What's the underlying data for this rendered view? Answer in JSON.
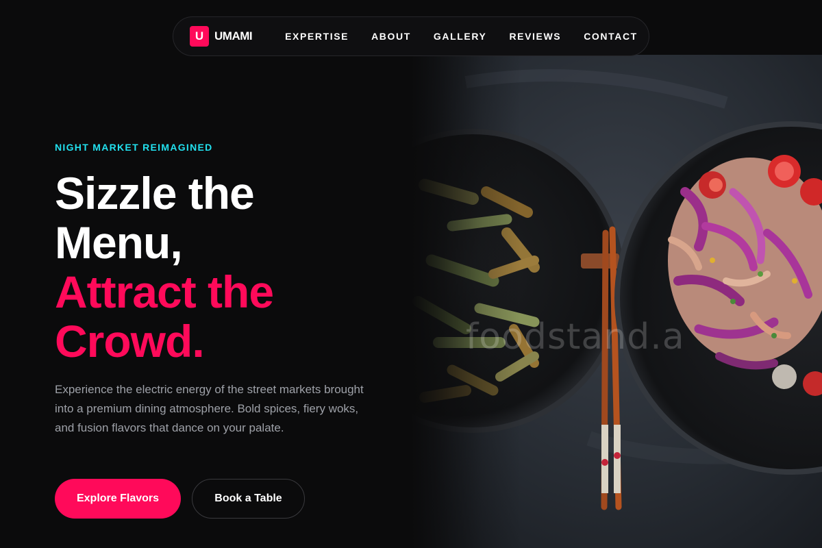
{
  "nav": {
    "brand_mark": "U",
    "brand_name": "UMAMI",
    "links": [
      "EXPERTISE",
      "ABOUT",
      "GALLERY",
      "REVIEWS",
      "CONTACT"
    ]
  },
  "hero": {
    "eyebrow": "NIGHT MARKET REIMAGINED",
    "headline_lines": [
      "Sizzle the",
      "Menu,",
      "Attract the",
      "Crowd."
    ],
    "description": "Experience the electric energy of the street markets brought into a premium dining atmosphere. Bold spices, fiery woks, and fusion flavors that dance on your palate.",
    "primary_cta": "Explore Flavors",
    "secondary_cta": "Book a Table",
    "image_watermark": "foodstand.a"
  },
  "colors": {
    "accent": "#ff0a5a",
    "eyebrow": "#22e1ef",
    "background": "#0b0b0c",
    "body_text": "#9ea1a8"
  }
}
